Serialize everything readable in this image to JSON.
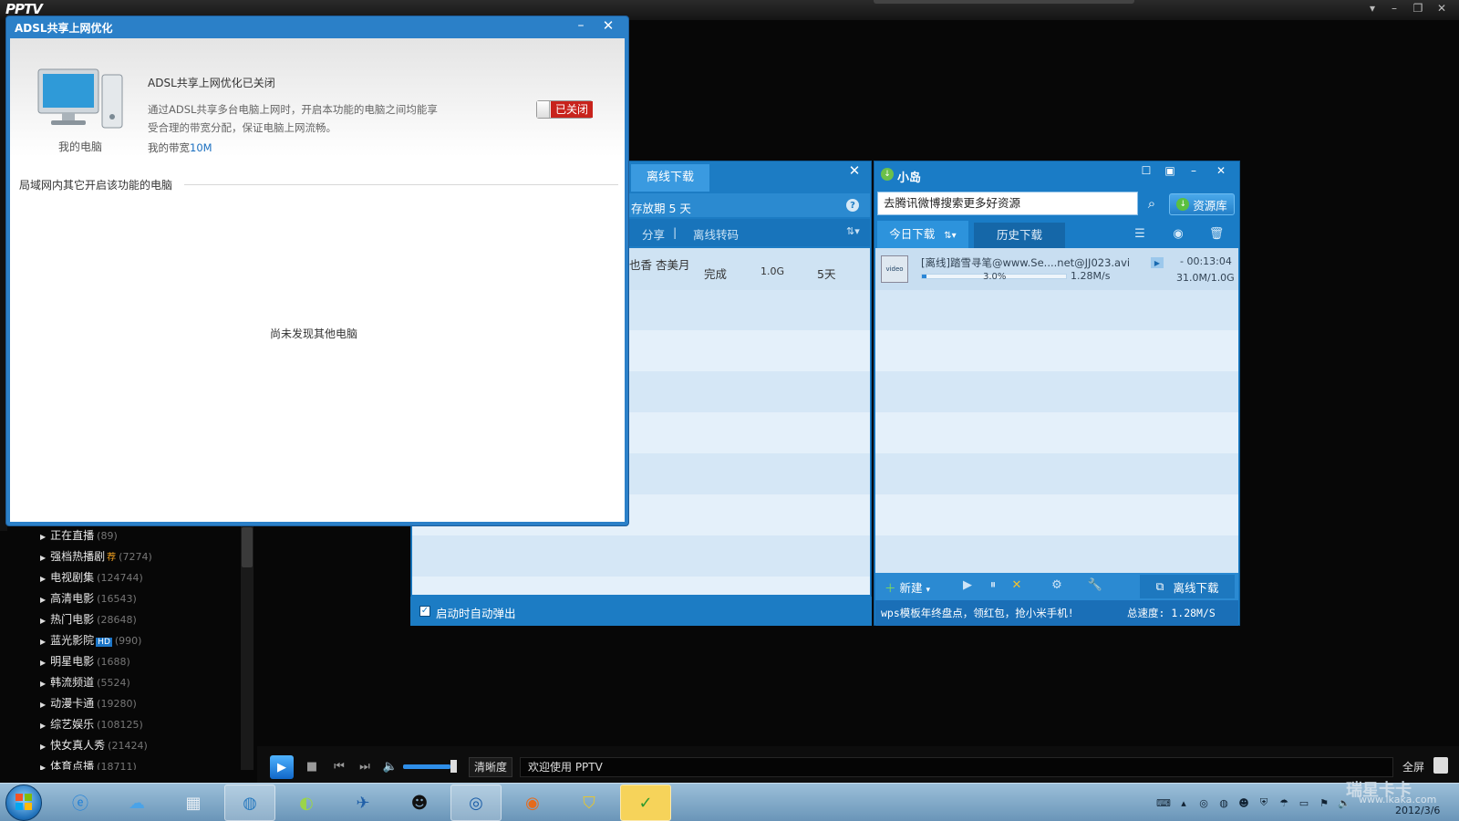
{
  "pptv": {
    "logo": "PPTV",
    "window_controls": [
      "▾",
      "–",
      "❐",
      "✕"
    ],
    "categories": [
      {
        "label": "正在直播",
        "count": "(89)",
        "tag": ""
      },
      {
        "label": "强档热播剧",
        "count": "(7274)",
        "tag": "荐"
      },
      {
        "label": "电视剧集",
        "count": "(124744)",
        "tag": ""
      },
      {
        "label": "高清电影",
        "count": "(16543)",
        "tag": ""
      },
      {
        "label": "热门电影",
        "count": "(28648)",
        "tag": ""
      },
      {
        "label": "蓝光影院",
        "count": "(990)",
        "tag": "HD"
      },
      {
        "label": "明星电影",
        "count": "(1688)",
        "tag": ""
      },
      {
        "label": "韩流频道",
        "count": "(5524)",
        "tag": ""
      },
      {
        "label": "动漫卡通",
        "count": "(19280)",
        "tag": ""
      },
      {
        "label": "综艺娱乐",
        "count": "(108125)",
        "tag": ""
      },
      {
        "label": "快女真人秀",
        "count": "(21424)",
        "tag": ""
      },
      {
        "label": "体育点播",
        "count": "(18711)",
        "tag": ""
      }
    ],
    "player": {
      "quality_label": "清晰度",
      "welcome_text": "欢迎使用 PPTV",
      "fullscreen_label": "全屏",
      "volume_level": 0.9
    }
  },
  "adsl": {
    "title": "ADSL共享上网优化",
    "pc_label": "我的电脑",
    "status_title": "ADSL共享上网优化已关闭",
    "desc_line1": "通过ADSL共享多台电脑上网时，开启本功能的电脑之间均能享",
    "desc_line2": "受合理的带宽分配，保证电脑上网流畅。",
    "bandwidth_label": "我的带宽",
    "bandwidth_value": "10M",
    "toggle_label": "已关闭",
    "lan_title": "局域网内其它开启该功能的电脑",
    "empty_text": "尚未发现其他电脑"
  },
  "offline": {
    "tab_label": "离线下载",
    "keep_text": "存放期 5 天",
    "toolbar": {
      "share": "分享",
      "transcode": "离线转码"
    },
    "row": {
      "name": "也香 杏美月",
      "status": "完成",
      "size": "1.0G",
      "days": "5天"
    },
    "auto_popup_label": "启动时自动弹出",
    "auto_popup_checked": true
  },
  "xiaodao": {
    "title": "小岛",
    "search_value": "去腾讯微博搜索更多好资源",
    "resource_label": "资源库",
    "tab_today": "今日下载",
    "tab_today_sort": "⇅▾",
    "tab_history": "历史下载",
    "task": {
      "icon_label": "video",
      "filename": "[离线]踏雪寻笔@www.Se....net@JJ023.avi",
      "percent": "3.0%",
      "progress": 0.03,
      "speed": "1.28M/s",
      "remaining": "- 00:13:04",
      "size": "31.0M/1.0G"
    },
    "new_label": "新建",
    "offline_label": "离线下载",
    "ad_text": "wps模板年终盘点，领红包，抢小米手机!",
    "total_speed": "总速度: 1.28M/S"
  },
  "taskbar": {
    "date": "2012/3/6",
    "watermark": "瑞星卡卡",
    "watermark_url": "www.ikaka.com"
  }
}
